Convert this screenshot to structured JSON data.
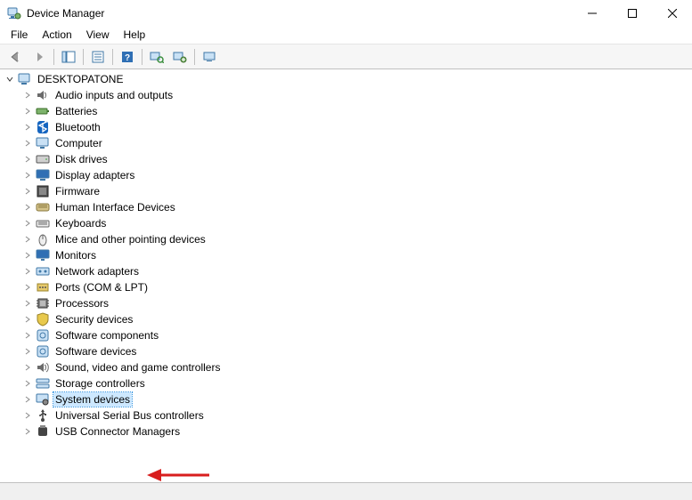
{
  "window": {
    "title": "Device Manager"
  },
  "menu": {
    "items": [
      "File",
      "Action",
      "View",
      "Help"
    ]
  },
  "toolbar": {
    "buttons": [
      {
        "name": "back-icon",
        "title": "Back"
      },
      {
        "name": "forward-icon",
        "title": "Forward"
      },
      {
        "sep": true
      },
      {
        "name": "show-hide-icon",
        "title": "Show/Hide Console Tree"
      },
      {
        "sep": true
      },
      {
        "name": "properties-icon",
        "title": "Properties"
      },
      {
        "sep": true
      },
      {
        "name": "help-icon",
        "title": "Help"
      },
      {
        "sep": true
      },
      {
        "name": "scan-icon",
        "title": "Scan for hardware changes"
      },
      {
        "name": "add-legacy-icon",
        "title": "Add legacy hardware"
      },
      {
        "sep": true
      },
      {
        "name": "devices-icon",
        "title": "Devices and Printers"
      }
    ]
  },
  "tree": {
    "root": "DESKTOPATONE",
    "categories": [
      {
        "label": "Audio inputs and outputs",
        "icon": "speaker-icon"
      },
      {
        "label": "Batteries",
        "icon": "battery-icon"
      },
      {
        "label": "Bluetooth",
        "icon": "bluetooth-icon"
      },
      {
        "label": "Computer",
        "icon": "computer-icon"
      },
      {
        "label": "Disk drives",
        "icon": "disk-icon"
      },
      {
        "label": "Display adapters",
        "icon": "display-icon"
      },
      {
        "label": "Firmware",
        "icon": "firmware-icon"
      },
      {
        "label": "Human Interface Devices",
        "icon": "hid-icon"
      },
      {
        "label": "Keyboards",
        "icon": "keyboard-icon"
      },
      {
        "label": "Mice and other pointing devices",
        "icon": "mouse-icon"
      },
      {
        "label": "Monitors",
        "icon": "monitor-icon"
      },
      {
        "label": "Network adapters",
        "icon": "network-icon"
      },
      {
        "label": "Ports (COM & LPT)",
        "icon": "port-icon"
      },
      {
        "label": "Processors",
        "icon": "cpu-icon"
      },
      {
        "label": "Security devices",
        "icon": "security-icon"
      },
      {
        "label": "Software components",
        "icon": "software-icon"
      },
      {
        "label": "Software devices",
        "icon": "software-icon"
      },
      {
        "label": "Sound, video and game controllers",
        "icon": "sound-icon"
      },
      {
        "label": "Storage controllers",
        "icon": "storage-icon"
      },
      {
        "label": "System devices",
        "icon": "system-icon",
        "selected": true
      },
      {
        "label": "Universal Serial Bus controllers",
        "icon": "usb-icon"
      },
      {
        "label": "USB Connector Managers",
        "icon": "usb-conn-icon"
      }
    ]
  },
  "annotation": {
    "arrow_color": "#d81e1e"
  }
}
